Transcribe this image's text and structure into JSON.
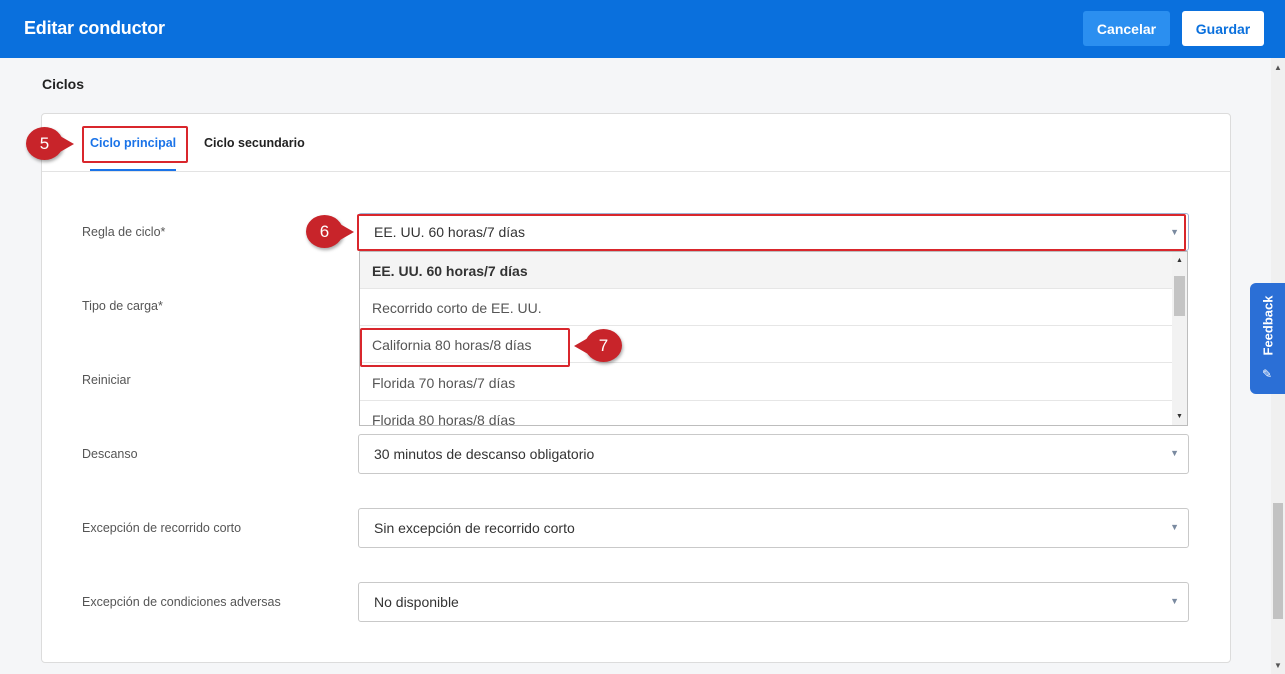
{
  "header": {
    "title": "Editar conductor",
    "cancel_label": "Cancelar",
    "save_label": "Guardar"
  },
  "section": {
    "title": "Ciclos"
  },
  "tabs": [
    {
      "label": "Ciclo principal",
      "active": true
    },
    {
      "label": "Ciclo secundario",
      "active": false
    }
  ],
  "fields": {
    "cycle_rule": {
      "label": "Regla de ciclo*",
      "value": "EE. UU. 60 horas/7 días"
    },
    "cargo_type": {
      "label": "Tipo de carga*"
    },
    "restart": {
      "label": "Reiniciar"
    },
    "break": {
      "label": "Descanso",
      "value": "30 minutos de descanso obligatorio"
    },
    "short_haul": {
      "label": "Excepción de recorrido corto",
      "value": "Sin excepción de recorrido corto"
    },
    "adverse": {
      "label": "Excepción de condiciones adversas",
      "value": "No disponible"
    }
  },
  "dropdown": {
    "options": [
      "EE. UU. 60 horas/7 días",
      "Recorrido corto de EE. UU.",
      "California 80 horas/8 días",
      "Florida 70 horas/7 días",
      "Florida 80 horas/8 días"
    ],
    "selected_index": 0
  },
  "callouts": [
    "5",
    "6",
    "7"
  ],
  "feedback": {
    "label": "Feedback"
  },
  "colors": {
    "header": "#0a70dd",
    "accent": "#1a73e8",
    "highlight": "#d9262c",
    "feedback": "#2b6fd6"
  }
}
